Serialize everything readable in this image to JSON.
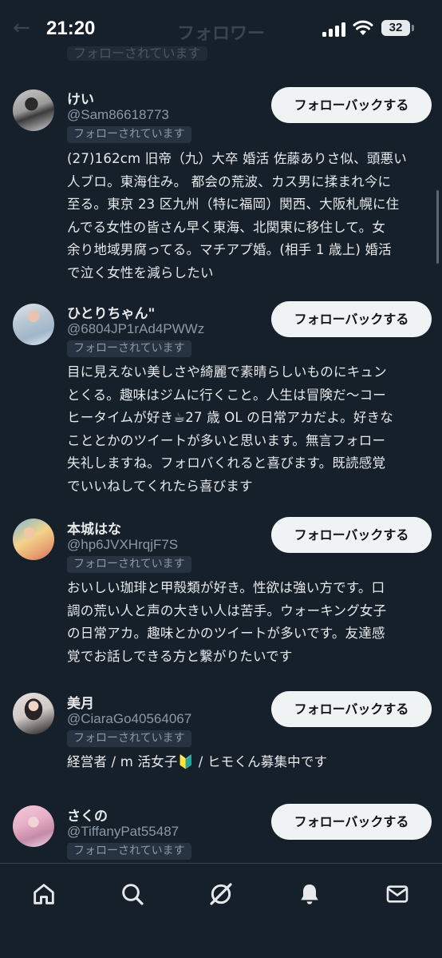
{
  "status_bar": {
    "time": "21:20",
    "battery": "32"
  },
  "header": {
    "title": "フォロワー"
  },
  "previous_item": {
    "badge": "フォローされています"
  },
  "follow_button_label": "フォローバックする",
  "followed_badge": "フォローされています",
  "users": [
    {
      "name": "けい",
      "handle": "@Sam86618773",
      "bio": "(27)162cm 旧帝（九）大卒 婚活 佐藤ありさ似、頭悪い\n人ブロ。東海住み。 都会の荒波、カス男に揉まれ今に\n至る。東京 23 区九州（特に福岡）関西、大阪札幌に住\nんでる女性の皆さん早く東海、北関東に移住して。女\n余り地域男腐ってる。マチアプ婚。(相手 1 歳上) 婚活\nで泣く女性を減らしたい"
    },
    {
      "name": "ひとりちゃん\"",
      "handle": "@6804JP1rAd4PWWz",
      "bio": "目に見えない美しさや綺麗で素晴らしいものにキュン\nとくる。趣味はジムに行くこと。人生は冒険だ〜コー\nヒータイムが好き☕27 歳 OL の日常アカだよ。好きな\nこととかのツイートが多いと思います。無言フォロー\n失礼しますね。フォロバくれると喜びます。既読感覚\nでいいねしてくれたら喜びます"
    },
    {
      "name": "本城はな",
      "handle": "@hp6JVXHrqjF7S",
      "bio": "おいしい珈琲と甲殻類が好き。性欲は強い方です。口\n調の荒い人と声の大きい人は苦手。ウォーキング女子\nの日常アカ。趣味とかのツイートが多いです。友達感\n覚でお話しできる方と繋がりたいです"
    },
    {
      "name": "美月",
      "handle": "@CiaraGo40564067",
      "bio": "経営者 / m 活女子🔰 / ヒモくん募集中です"
    },
    {
      "name": "さくの",
      "handle": "@TiffanyPat55487",
      "bio": ""
    }
  ],
  "tab_bar": {
    "items": [
      {
        "icon": "home-icon"
      },
      {
        "icon": "search-icon"
      },
      {
        "icon": "grok-icon"
      },
      {
        "icon": "bell-icon"
      },
      {
        "icon": "mail-icon"
      }
    ]
  },
  "colors": {
    "background": "#15202b",
    "text": "#e7e9ea",
    "secondary": "#8b98a5",
    "button_bg": "#eff3f4"
  }
}
